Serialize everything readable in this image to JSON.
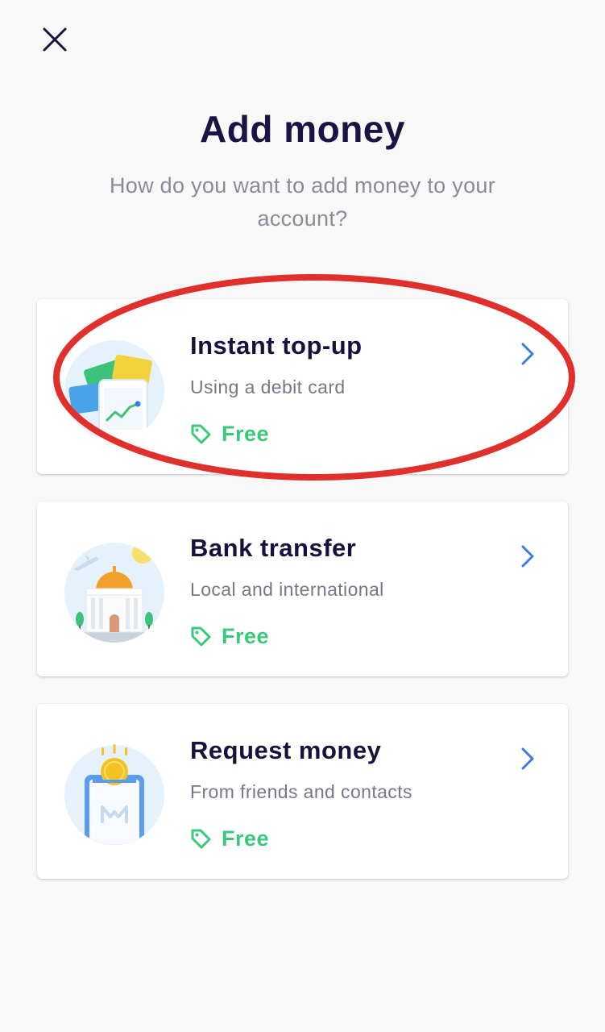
{
  "header": {
    "close_icon": "close-icon",
    "title": "Add money",
    "subtitle": "How do you want to add money to your account?"
  },
  "options": [
    {
      "title": "Instant top-up",
      "description": "Using a debit card",
      "fee": "Free",
      "icon": "debit-card-illustration"
    },
    {
      "title": "Bank transfer",
      "description": "Local and international",
      "fee": "Free",
      "icon": "bank-building-illustration"
    },
    {
      "title": "Request money",
      "description": "From friends and contacts",
      "fee": "Free",
      "icon": "request-money-illustration"
    }
  ],
  "colors": {
    "title": "#1a1444",
    "subtitle": "#8a8b98",
    "fee_green": "#3ac87a",
    "chevron_blue": "#3b7be0",
    "highlight_red": "#e0302b",
    "background": "#f8f8f9"
  }
}
